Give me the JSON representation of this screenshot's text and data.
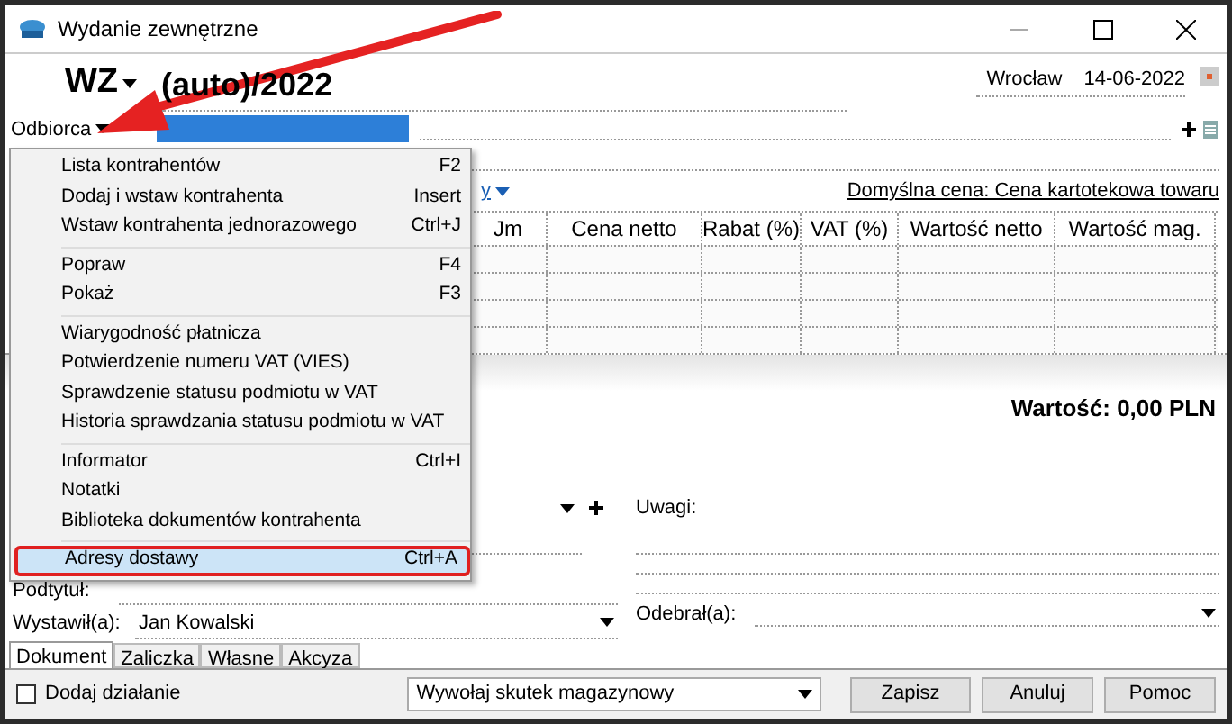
{
  "window": {
    "title": "Wydanie zewnętrzne"
  },
  "header": {
    "doc_type": "WZ",
    "number": "(auto)/2022",
    "place": "Wrocław",
    "date": "14-06-2022"
  },
  "recipient": {
    "label": "Odbiorca"
  },
  "price_link": "y",
  "default_price": "Domyślna cena: Cena kartotekowa towaru",
  "table": {
    "columns": [
      "Jm",
      "Cena netto",
      "Rabat (%)",
      "VAT (%)",
      "Wartość netto",
      "Wartość mag."
    ]
  },
  "total": "Wartość: 0,00 PLN",
  "context_menu": {
    "groups": [
      [
        {
          "label": "Lista kontrahentów",
          "shortcut": "F2",
          "selected": false
        },
        {
          "label": "Dodaj i wstaw kontrahenta",
          "shortcut": "Insert",
          "selected": false
        },
        {
          "label": "Wstaw kontrahenta jednorazowego",
          "shortcut": "Ctrl+J",
          "selected": false
        }
      ],
      [
        {
          "label": "Popraw",
          "shortcut": "F4",
          "selected": false
        },
        {
          "label": "Pokaż",
          "shortcut": "F3",
          "selected": false
        }
      ],
      [
        {
          "label": "Wiarygodność płatnicza",
          "selected": false
        },
        {
          "label": "Potwierdzenie numeru VAT (VIES)",
          "selected": false
        },
        {
          "label": "Sprawdzenie statusu podmiotu w VAT",
          "selected": false
        },
        {
          "label": "Historia sprawdzania statusu podmiotu w VAT",
          "selected": false
        }
      ],
      [
        {
          "label": "Informator",
          "shortcut": "Ctrl+I",
          "selected": false
        },
        {
          "label": "Notatki",
          "selected": false
        },
        {
          "label": "Biblioteka dokumentów kontrahenta",
          "selected": false
        }
      ],
      [
        {
          "label": "Adresy dostawy",
          "shortcut": "Ctrl+A",
          "selected": true
        }
      ]
    ]
  },
  "notes": {
    "label": "Uwagi:"
  },
  "subtitle": {
    "label": "Podtytuł:"
  },
  "issued_by": {
    "label": "Wystawił(a):",
    "value": "Jan Kowalski"
  },
  "received_by": {
    "label": "Odebrał(a):"
  },
  "tabs": [
    {
      "label": "Dokument",
      "selected": true
    },
    {
      "label": "Zaliczka",
      "selected": false
    },
    {
      "label": "Własne",
      "selected": false
    },
    {
      "label": "Akcyza",
      "selected": false
    }
  ],
  "add_action": {
    "label": "Dodaj działanie",
    "checked": false
  },
  "stock_effect": {
    "value": "Wywołaj skutek magazynowy"
  },
  "buttons": [
    "Zapisz",
    "Anuluj",
    "Pomoc"
  ]
}
